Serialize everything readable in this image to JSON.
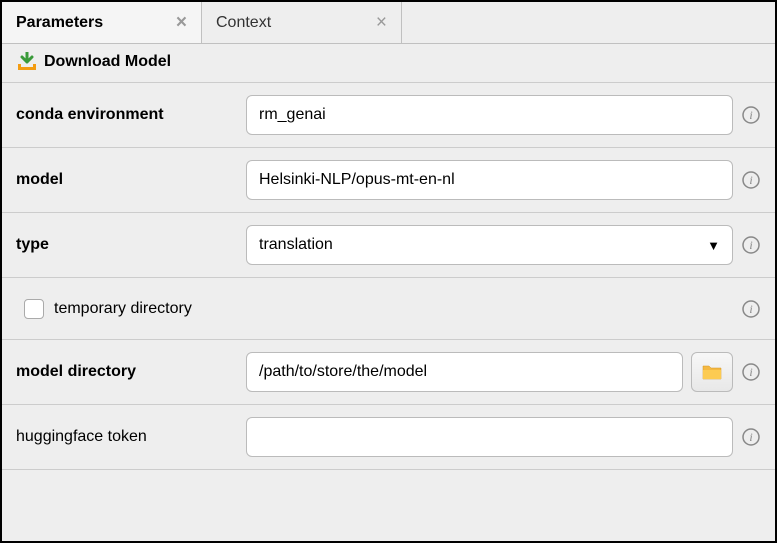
{
  "tabs": {
    "parameters": "Parameters",
    "context": "Context"
  },
  "subheader": {
    "title": "Download Model"
  },
  "fields": {
    "conda_env": {
      "label": "conda environment",
      "value": "rm_genai"
    },
    "model": {
      "label": "model",
      "value": "Helsinki-NLP/opus-mt-en-nl"
    },
    "type": {
      "label": "type",
      "value": "translation"
    },
    "temp_dir": {
      "label": "temporary directory"
    },
    "model_dir": {
      "label": "model directory",
      "value": "/path/to/store/the/model"
    },
    "hf_token": {
      "label": "huggingface token",
      "value": ""
    }
  }
}
